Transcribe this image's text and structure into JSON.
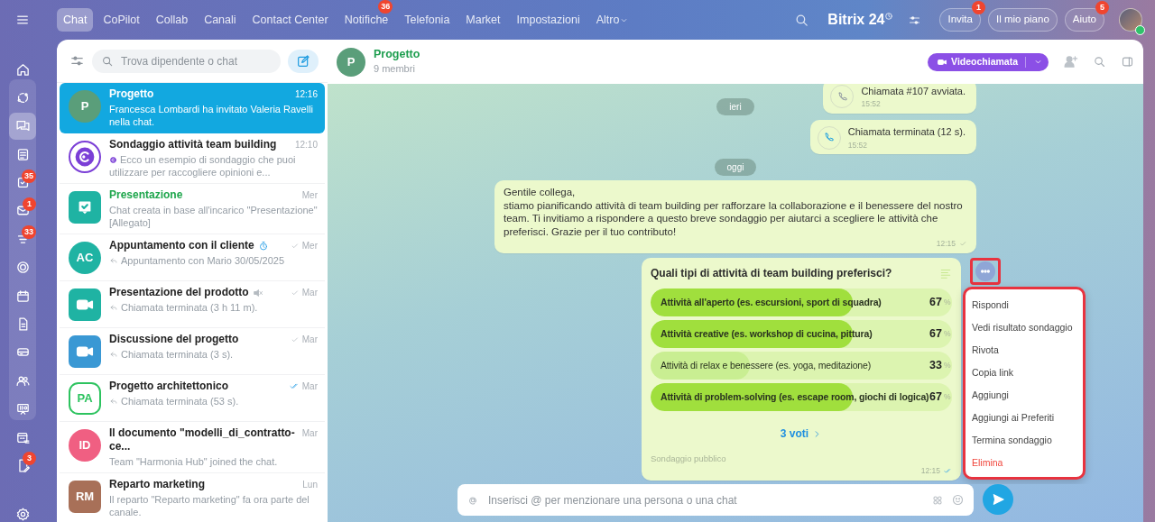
{
  "topbar": {
    "tabs": [
      {
        "label": "Chat",
        "selected": true
      },
      {
        "label": "CoPilot",
        "selected": false
      },
      {
        "label": "Collab",
        "selected": false
      },
      {
        "label": "Canali",
        "selected": false
      },
      {
        "label": "Contact Center",
        "selected": false
      },
      {
        "label": "Notifiche",
        "selected": false,
        "badge": "36"
      },
      {
        "label": "Telefonia",
        "selected": false
      },
      {
        "label": "Market",
        "selected": false
      },
      {
        "label": "Impostazioni",
        "selected": false
      },
      {
        "label": "Altro",
        "selected": false,
        "dropdown": true
      }
    ],
    "logo": "Bitrix 24",
    "buttons": [
      {
        "label": "Invita",
        "badge": "1"
      },
      {
        "label": "Il mio piano"
      },
      {
        "label": "Aiuto",
        "badge": "5"
      }
    ]
  },
  "rail": [
    {
      "selected": false
    },
    {
      "selected": false
    },
    {
      "selected": true
    },
    {
      "selected": false
    },
    {
      "selected": false,
      "badge": "35"
    },
    {
      "selected": false,
      "badge": "1"
    },
    {
      "selected": false,
      "badge": "33"
    },
    {
      "selected": false
    },
    {
      "selected": false
    },
    {
      "selected": false
    },
    {
      "selected": false
    },
    {
      "selected": false
    },
    {
      "selected": false
    },
    {
      "selected": false
    },
    {
      "selected": false,
      "badge": "3"
    },
    {
      "selected": false
    }
  ],
  "chat_list": {
    "search": {
      "placeholder": "Trova dipendente o chat"
    },
    "items": [
      {
        "title": "Progetto",
        "time": "12:16",
        "preview": "Francesca Lombardi ha invitato Valeria Ravelli nella chat.",
        "selected": true,
        "avatar": {
          "kind": "circle",
          "text": "P",
          "color": "#5a9e7a"
        }
      },
      {
        "title": "Sondaggio attività team building",
        "time": "12:10",
        "preview": "Ecco un esempio di sondaggio che puoi utilizzare per raccogliere opinioni e...",
        "author_icon": true,
        "selected": false,
        "avatar": {
          "kind": "poll",
          "color": "#7b3fd6"
        }
      },
      {
        "title": "Presentazione",
        "color": "#1ea64c",
        "time": "Mer",
        "preview": "Chat creata in base all'incarico \"Presentazione\" [Allegato]",
        "selected": false,
        "avatar": {
          "kind": "task",
          "color": "#1fb3a3"
        }
      },
      {
        "title": "Appuntamento con il cliente",
        "timer": true,
        "time": "Mer",
        "delivered": true,
        "preview": "Appuntamento con Mario 30/05/2025",
        "reply": true,
        "selected": false,
        "avatar": {
          "kind": "circle",
          "text": "AC",
          "color": "#1fb3a3"
        }
      },
      {
        "title": "Presentazione del prodotto",
        "muted": true,
        "time": "Mar",
        "delivered": true,
        "preview": "Chiamata terminata (3 h 11 m).",
        "reply": true,
        "selected": false,
        "avatar": {
          "kind": "video",
          "color": "#1fb3a3"
        }
      },
      {
        "title": "Discussione del progetto",
        "time": "Mar",
        "delivered": true,
        "preview": "Chiamata terminata (3 s).",
        "reply": true,
        "selected": false,
        "avatar": {
          "kind": "video",
          "color": "#3a98d4"
        }
      },
      {
        "title": "Progetto architettonico",
        "time": "Mar",
        "read": true,
        "preview": "Chiamata terminata (53 s).",
        "reply": true,
        "selected": false,
        "avatar": {
          "kind": "hexagon",
          "text": "PA",
          "color": "#2dc35f"
        }
      },
      {
        "title": "Il documento \"modelli_di_contratto-ce...",
        "time": "Mar",
        "preview": "Team \"Harmonia Hub\" joined the chat.",
        "selected": false,
        "avatar": {
          "kind": "circle",
          "text": "ID",
          "color": "#f05f82"
        }
      },
      {
        "title": "Reparto marketing",
        "time": "Lun",
        "preview": "Il reparto \"Reparto marketing\" fa ora parte del canale.",
        "selected": false,
        "avatar": {
          "kind": "square",
          "text": "RM",
          "color": "#a87058"
        }
      }
    ]
  },
  "chat": {
    "title": "Progetto",
    "subtitle": "9 membri",
    "avatar": {
      "text": "P",
      "color": "#5a9e7a"
    },
    "call_button": "Videochiamata",
    "messages": [
      {
        "kind": "call",
        "text": "Chiamata #107 avviata.",
        "time": "15:52",
        "ended": false
      },
      {
        "kind": "date",
        "text": "ieri"
      },
      {
        "kind": "call",
        "text": "Chiamata terminata (12 s).",
        "time": "15:52",
        "ended": true
      },
      {
        "kind": "date",
        "text": "oggi"
      },
      {
        "kind": "text",
        "text": "Gentile collega,\nstiamo pianificando attività di team building per rafforzare la collaborazione e il benessere del nostro team. Ti invitiamo a rispondere a questo breve sondaggio per aiutarci a scegliere le attività che preferisci. Grazie per il tuo contributo!",
        "time": "12:15",
        "read": false
      },
      {
        "kind": "poll",
        "question": "Quali tipi di attività di team building preferisci?",
        "more_highlighted": true,
        "options": [
          {
            "text": "Attività all'aperto (es. escursioni, sport di squadra)",
            "level": 0.67,
            "percent": "67",
            "unit": "%",
            "selected": true
          },
          {
            "text": "Attività creative (es. workshop di cucina, pittura)",
            "level": 0.67,
            "percent": "67",
            "unit": "%",
            "selected": true
          },
          {
            "text": "Attività di relax e benessere (es. yoga, meditazione)",
            "level": 0.33,
            "percent": "33",
            "unit": "%",
            "selected": false
          },
          {
            "text": "Attività di problem-solving (es. escape room, giochi di logica)",
            "level": 0.67,
            "percent": "67",
            "unit": "%",
            "selected": true
          }
        ],
        "votes": "3 voti",
        "visibility": "Sondaggio pubblico",
        "time": "12:15",
        "read": true
      }
    ],
    "composer": {
      "placeholder": "Inserisci @ per menzionare una persona o una chat"
    }
  },
  "context_menu": {
    "highlighted": true,
    "items": [
      {
        "label": "Rispondi",
        "kind": "normal"
      },
      {
        "label": "Vedi risultato sondaggio",
        "kind": "normal"
      },
      {
        "label": "Rivota",
        "kind": "normal"
      },
      {
        "label": "Copia link",
        "kind": "normal"
      },
      {
        "label": "Aggiungi",
        "kind": "normal"
      },
      {
        "label": "Aggiungi ai Preferiti",
        "kind": "normal"
      },
      {
        "label": "Termina sondaggio",
        "kind": "normal"
      },
      {
        "label": "Elimina",
        "kind": "danger"
      }
    ]
  }
}
